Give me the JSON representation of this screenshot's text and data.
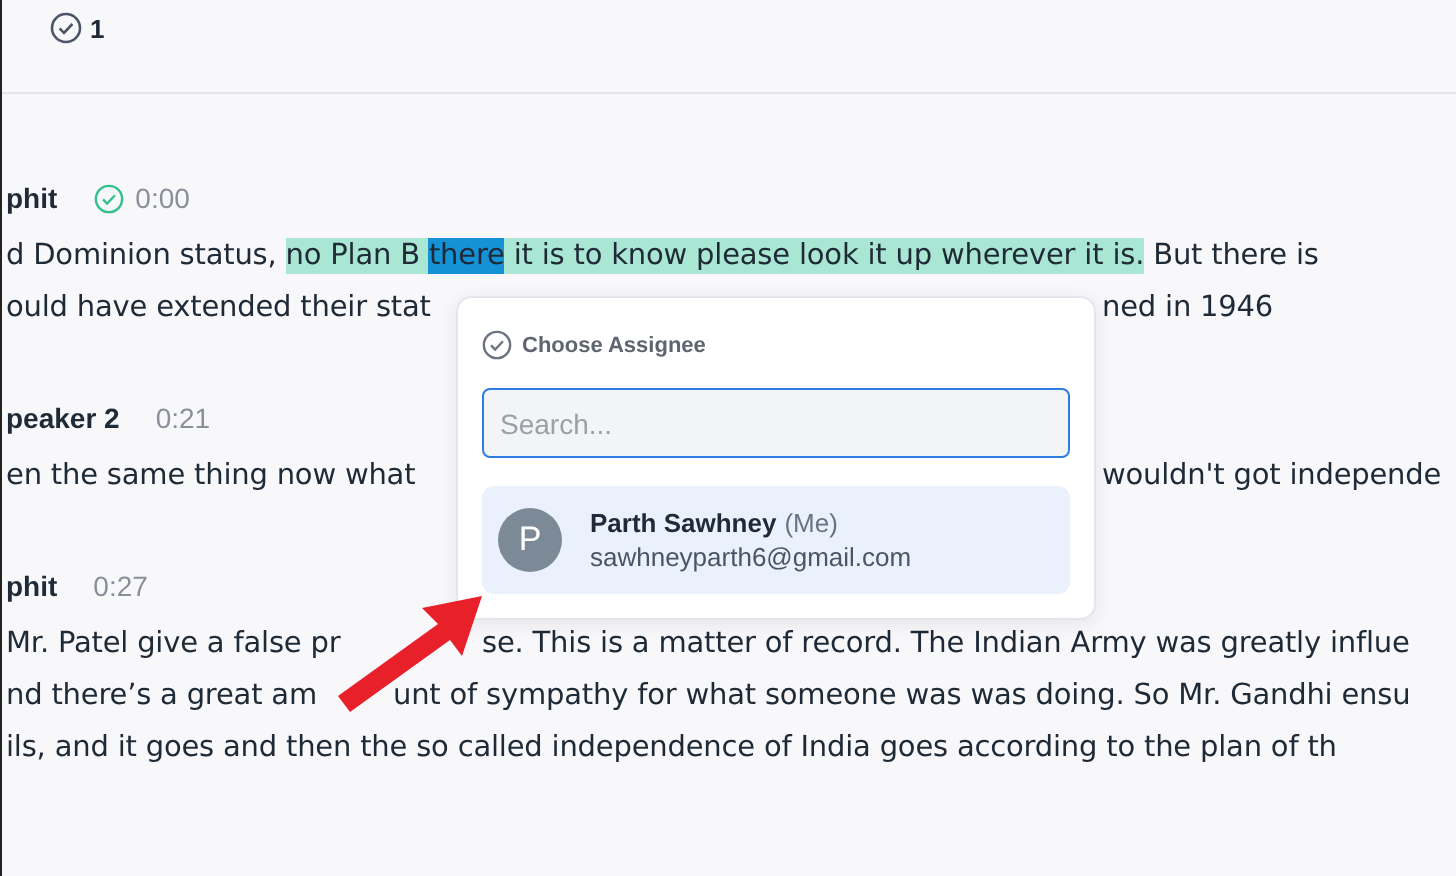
{
  "toolbar": {
    "resolved_count": "1"
  },
  "blocks": [
    {
      "speaker": "phit",
      "time": "0:00",
      "verified": true,
      "lines": [
        {
          "kind": "full",
          "left": [
            {
              "text": "d Dominion status, ",
              "highlighted": false,
              "selected": false
            },
            {
              "text": "no Plan B ",
              "highlighted": true,
              "selected": false
            },
            {
              "text": "there",
              "highlighted": true,
              "selected": true
            },
            {
              "text": " it is to know please look it up wherever it is.",
              "highlighted": true,
              "selected": false
            },
            {
              "text": " But there is",
              "highlighted": false,
              "selected": false
            }
          ]
        },
        {
          "kind": "around_popup",
          "left": [
            {
              "text": "ould have extended their stat"
            }
          ],
          "right": [
            {
              "text": "ned in 1946"
            }
          ]
        }
      ]
    },
    {
      "speaker": "peaker 2",
      "time": "0:21",
      "verified": false,
      "lines": [
        {
          "kind": "around_popup",
          "left": [
            {
              "text": "en the same thing now what"
            }
          ],
          "right": [
            {
              "text": "wouldn't got independe"
            }
          ]
        }
      ]
    },
    {
      "speaker": "phit",
      "time": "0:27",
      "verified": false,
      "lines": [
        {
          "kind": "around_arrow_head",
          "left": [
            {
              "text": "Mr. Patel give a false pr"
            }
          ],
          "right": [
            {
              "text": "se. This is a matter of record. The Indian Army was greatly influe"
            }
          ]
        },
        {
          "kind": "across_arrow_tail",
          "left": [
            {
              "text": "nd there’s a great am"
            }
          ],
          "right": [
            {
              "text": "unt of sympathy for what someone was was doing. So Mr. Gandhi ensu"
            }
          ]
        },
        {
          "kind": "full",
          "left": [
            {
              "text": "ils, and it goes and then the so called independence of India goes according to the plan of th"
            }
          ]
        }
      ]
    }
  ],
  "popup": {
    "title": "Choose Assignee",
    "search": {
      "placeholder": "Search..."
    },
    "people": [
      {
        "initial": "P",
        "name": "Parth Sawhney",
        "tag": "(Me)",
        "email": "sawhneyparth6@gmail.com",
        "selected": true
      }
    ]
  }
}
